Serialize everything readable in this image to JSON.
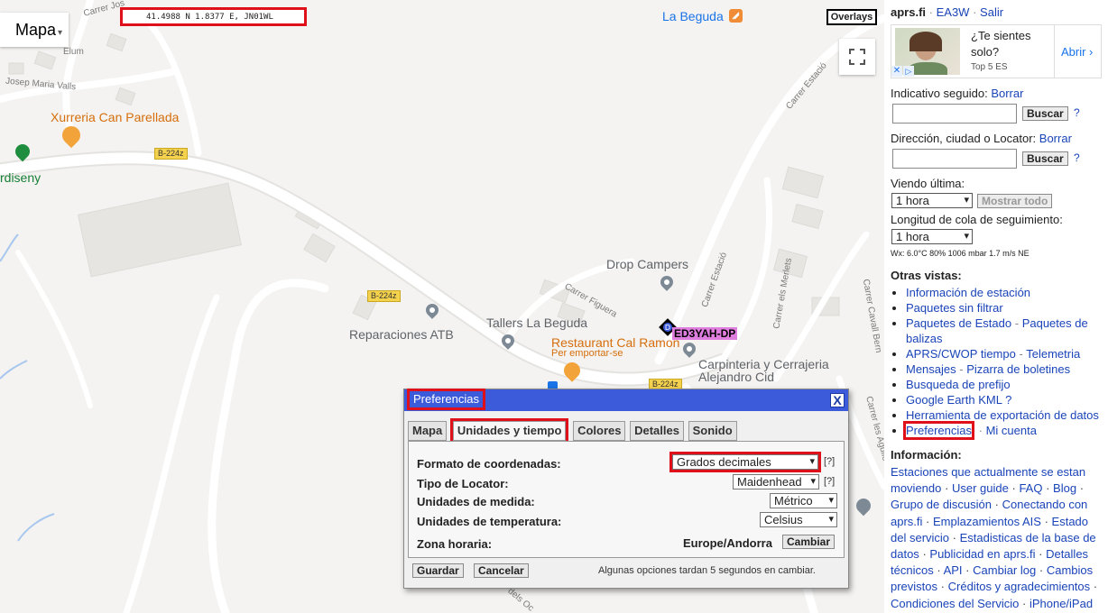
{
  "map": {
    "type_label": "Mapa",
    "coords": "41.4988 N 1.8377 E, JN01WL",
    "overlays_label": "Overlays",
    "town": "La Beguda",
    "station_label": "ED3YAH-DP",
    "pois": {
      "xurreria": "Xurreria Can Parellada",
      "cardiseny": "rdiseny",
      "drop_campers": "Drop Campers",
      "tallers": "Tallers La Beguda",
      "reparaciones": "Reparaciones ATB",
      "restaurant": "Restaurant Cal Ramon",
      "restaurant_sub": "Per emportar-se",
      "carpinteria_1": "Carpinteria y Cerrajeria",
      "carpinteria_2": "Alejandro Cid"
    },
    "streets": {
      "s1": "Carrer Jos",
      "s2": "Elum",
      "s3": "Josep Maria Valls",
      "s4": "Carrer Estació",
      "s5": "Carrer Estació",
      "s6": "Carrer Figuera",
      "s7": "Carrer els Merlets",
      "s8": "Carrer Cavall Bern",
      "s9": "Carrer les Agulle",
      "s10": "dels Oc"
    },
    "roads": {
      "r1": "B-224z",
      "r2": "B-224z",
      "r3": "B-224z"
    }
  },
  "dialog": {
    "title": "Preferencias",
    "close": "X",
    "tabs": [
      "Mapa",
      "Unidades y tiempo",
      "Colores",
      "Detalles",
      "Sonido"
    ],
    "rows": {
      "coord_label": "Formato de coordenadas:",
      "coord_value": "Grados decimales",
      "locator_label": "Tipo de Locator:",
      "locator_value": "Maidenhead",
      "units_label": "Unidades de medida:",
      "units_value": "Métrico",
      "temp_label": "Unidades de temperatura:",
      "temp_value": "Celsius",
      "tz_label": "Zona horaria:",
      "tz_value": "Europe/Andorra",
      "change_button": "Cambiar"
    },
    "help": "[?]",
    "save_button": "Guardar",
    "cancel_button": "Cancelar",
    "note": "Algunas opciones tardan 5 segundos en cambiar."
  },
  "sidebar": {
    "site": "aprs.fi",
    "sep": "·",
    "callsign": "EA3W",
    "logout": "Salir",
    "ad": {
      "line1": "¿Te sientes",
      "line2": "solo?",
      "source": "Top 5 ES",
      "cta": "Abrir ›"
    },
    "tracked_label": "Indicativo seguido:",
    "tracked_clear": "Borrar",
    "search_button": "Buscar",
    "help": "?",
    "address_label": "Dirección, ciudad o Locator:",
    "address_clear": "Borrar",
    "last_label": "Viendo última:",
    "last_value": "1 hora",
    "show_all": "Mostrar todo",
    "tail_label": "Longitud de cola de seguimiento:",
    "tail_value": "1 hora",
    "wx": "Wx: 6.0°C 80% 1006 mbar 1.7 m/s NE",
    "other_views_title": "Otras vistas:",
    "views": {
      "v1": "Información de estación",
      "v2": "Paquetes sin filtrar",
      "v3a": "Paquetes de Estado",
      "v3b": "Paquetes de balizas",
      "v4a": "APRS/CWOP tiempo",
      "v4b": "Telemetria",
      "v5a": "Mensajes",
      "v5b": "Pizarra de boletines",
      "v6": "Busqueda de prefijo",
      "v7": "Google Earth KML",
      "v7q": "?",
      "v8": "Herramienta de exportación de datos",
      "v9": "Preferencias",
      "v9b": "Mi cuenta"
    },
    "info_title": "Información:",
    "info_links": {
      "l1": "Estaciones que actualmente se estan moviendo",
      "l2": "User guide",
      "l3": "FAQ",
      "l4": "Blog",
      "l5": "Grupo de discusión",
      "l6": "Conectando con aprs.fi",
      "l7": "Emplazamientos AIS",
      "l8": "Estado del servicio",
      "l9": "Estadisticas de la base de datos",
      "l10": "Publicidad en aprs.fi",
      "l11": "Detalles técnicos",
      "l12": "API",
      "l13": "Cambiar log",
      "l14": "Cambios previstos",
      "l15": "Créditos y agradecimientos",
      "l16": "Condiciones del Servicio",
      "l17": "iPhone/iPad APRS"
    }
  }
}
